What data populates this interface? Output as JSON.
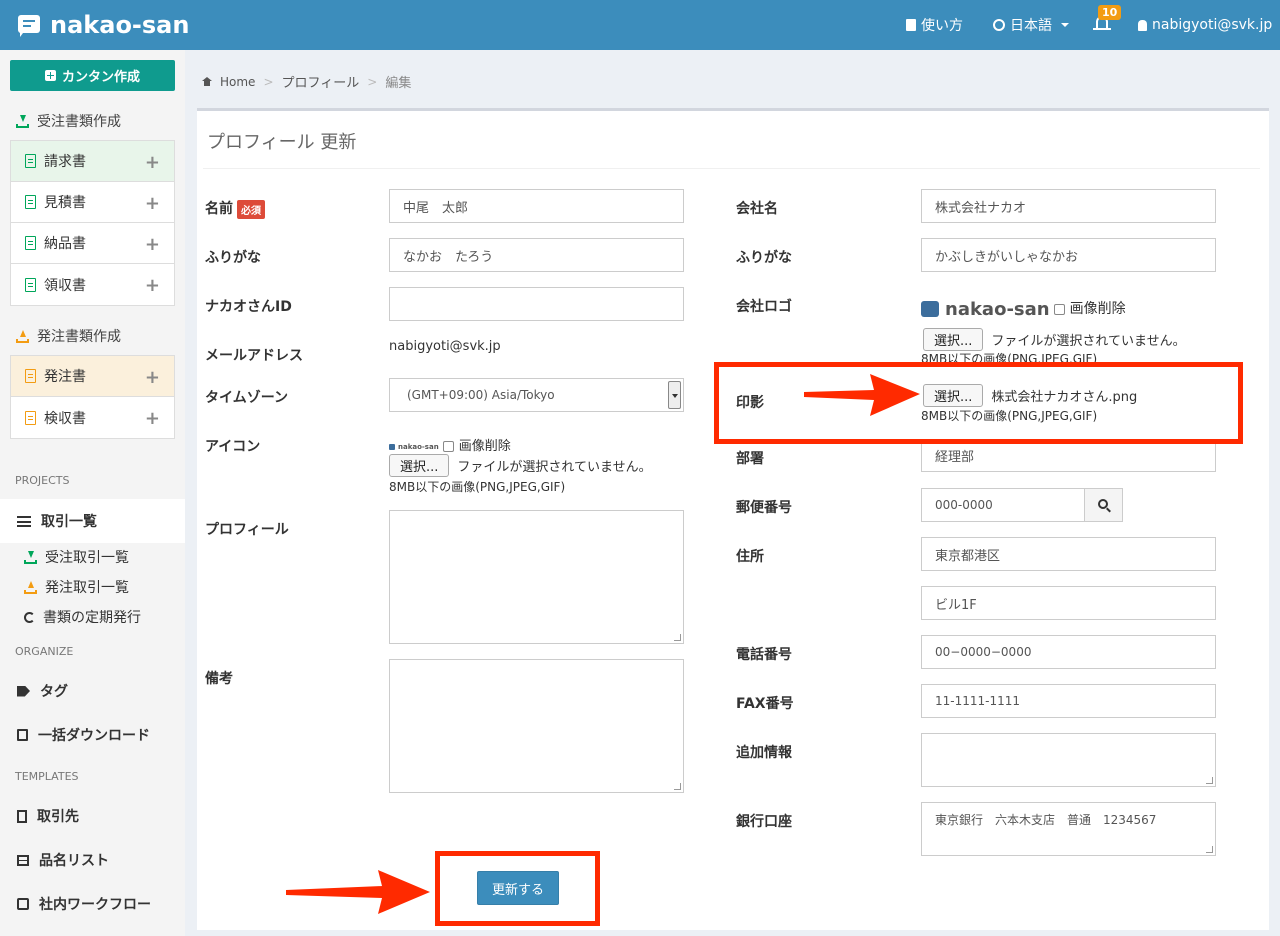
{
  "header": {
    "brand": "nakao-san",
    "help": "使い方",
    "language": "日本語",
    "notifications": "10",
    "user": "nabigyoti@svk.jp"
  },
  "sidebar": {
    "create_button": "カンタン作成",
    "received_section": "受注書類作成",
    "received_docs": [
      "請求書",
      "見積書",
      "納品書",
      "領収書"
    ],
    "ordered_section": "発注書類作成",
    "ordered_docs": [
      "発注書",
      "検収書"
    ],
    "projects_header": "PROJECTS",
    "transactions": "取引一覧",
    "received_tx": "受注取引一覧",
    "ordered_tx": "発注取引一覧",
    "recurring": "書類の定期発行",
    "organize_header": "ORGANIZE",
    "tags": "タグ",
    "bulk_download": "一括ダウンロード",
    "templates_header": "TEMPLATES",
    "partners": "取引先",
    "items": "品名リスト",
    "workflow": "社内ワークフロー"
  },
  "breadcrumb": {
    "home": "Home",
    "profile": "プロフィール",
    "edit": "編集"
  },
  "form": {
    "title": "プロフィール 更新",
    "required_badge": "必須",
    "left": {
      "name_label": "名前",
      "name_value": "中尾　太郎",
      "furigana_label": "ふりがな",
      "furigana_value": "なかお　たろう",
      "id_label": "ナカオさんID",
      "id_value": "",
      "email_label": "メールアドレス",
      "email_value": "nabigyoti@svk.jp",
      "tz_label": "タイムゾーン",
      "tz_value": "(GMT+09:00) Asia/Tokyo",
      "icon_label": "アイコン",
      "icon_logo": "nakao-san",
      "icon_delete": "画像削除",
      "file_button": "選択...",
      "no_file": "ファイルが選択されていません。",
      "file_hint": "8MB以下の画像(PNG,JPEG,GIF)",
      "profile_label": "プロフィール",
      "profile_value": "",
      "notes_label": "備考",
      "notes_value": ""
    },
    "right": {
      "company_label": "会社名",
      "company_value": "株式会社ナカオ",
      "furigana_label": "ふりがな",
      "furigana_value": "かぶしきがいしゃなかお",
      "logo_label": "会社ロゴ",
      "logo_brand": "nakao-san",
      "logo_delete": "画像削除",
      "file_button": "選択...",
      "no_file": "ファイルが選択されていません。",
      "file_hint": "8MB以下の画像(PNG,JPEG,GIF)",
      "seal_label": "印影",
      "seal_file": "株式会社ナカオさん.png",
      "seal_hint": "8MB以下の画像(PNG,JPEG,GIF)",
      "dept_label": "部署",
      "dept_value": "経理部",
      "zip_label": "郵便番号",
      "zip_value": "000-0000",
      "address_label": "住所",
      "address1": "東京都港区",
      "address2": "ビル1F",
      "phone_label": "電話番号",
      "phone_value": "00−0000−0000",
      "fax_label": "FAX番号",
      "fax_value": "11-1111-1111",
      "extra_label": "追加情報",
      "extra_value": "",
      "bank_label": "銀行口座",
      "bank_value": "東京銀行　六本木支店　普通　1234567"
    },
    "submit": "更新する"
  },
  "colors": {
    "header": "#3c8dbc",
    "annotation": "#ff2a00",
    "teal": "#0f9b8e"
  }
}
